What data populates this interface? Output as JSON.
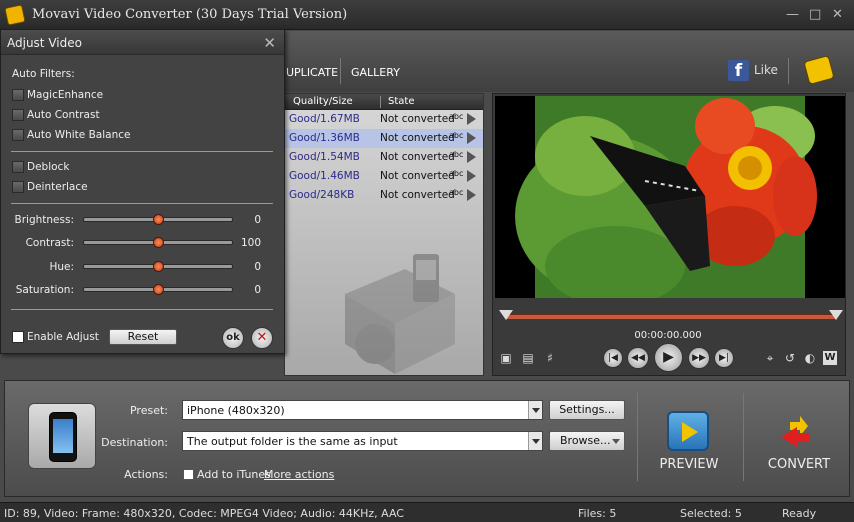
{
  "window": {
    "title": "Movavi Video Converter (30 Days Trial Version)"
  },
  "toolbar": {
    "tab_duplicate": "UPLICATE",
    "tab_gallery": "GALLERY",
    "like": "Like",
    "facebook_glyph": "f"
  },
  "file_list": {
    "columns": [
      "Quality/Size",
      "State"
    ],
    "rows": [
      {
        "quality": "Good/1.67MB",
        "state": "Not converted",
        "tag": "abc",
        "selected": false
      },
      {
        "quality": "Good/1.36MB",
        "state": "Not converted",
        "tag": "abc",
        "selected": true
      },
      {
        "quality": "Good/1.54MB",
        "state": "Not converted",
        "tag": "abc",
        "selected": false
      },
      {
        "quality": "Good/1.46MB",
        "state": "Not converted",
        "tag": "abc",
        "selected": false
      },
      {
        "quality": "Good/248KB",
        "state": "Not converted",
        "tag": "abc",
        "selected": false
      }
    ]
  },
  "player": {
    "timecode": "00:00:00.000",
    "progress": 0
  },
  "dialog": {
    "title": "Adjust Video",
    "auto_filters_label": "Auto Filters:",
    "filters": [
      "MagicEnhance",
      "Auto Contrast",
      "Auto White Balance"
    ],
    "extra_filters": [
      "Deblock",
      "Deinterlace"
    ],
    "sliders": [
      {
        "label": "Brightness:",
        "value": "0",
        "level": 0.5
      },
      {
        "label": "Contrast:",
        "value": "100",
        "level": 0.5
      },
      {
        "label": "Hue:",
        "value": "0",
        "level": 0.5
      },
      {
        "label": "Saturation:",
        "value": "0",
        "level": 0.5
      }
    ],
    "enable_adjust": "Enable Adjust",
    "reset": "Reset",
    "ok": "ok",
    "cancel_glyph": "✕",
    "close_glyph": "✕"
  },
  "bottom": {
    "preset_label": "Preset:",
    "preset_value": "iPhone (480x320)",
    "settings": "Settings...",
    "destination_label": "Destination:",
    "destination_value": "The output folder is the same as input",
    "browse": "Browse...",
    "actions_label": "Actions:",
    "add_itunes": "Add to iTunes",
    "more_actions": "More actions",
    "preview": "PREVIEW",
    "convert": "CONVERT"
  },
  "status": {
    "info": "ID: 89, Video: Frame: 480x320, Codec: MPEG4 Video; Audio: 44KHz, AAC",
    "files": "Files: 5",
    "selected": "Selected: 5",
    "state": "Ready"
  },
  "colors": {
    "accent_red": "#c85a3c",
    "selection": "#b7c4e6",
    "facebook": "#3b5998"
  }
}
